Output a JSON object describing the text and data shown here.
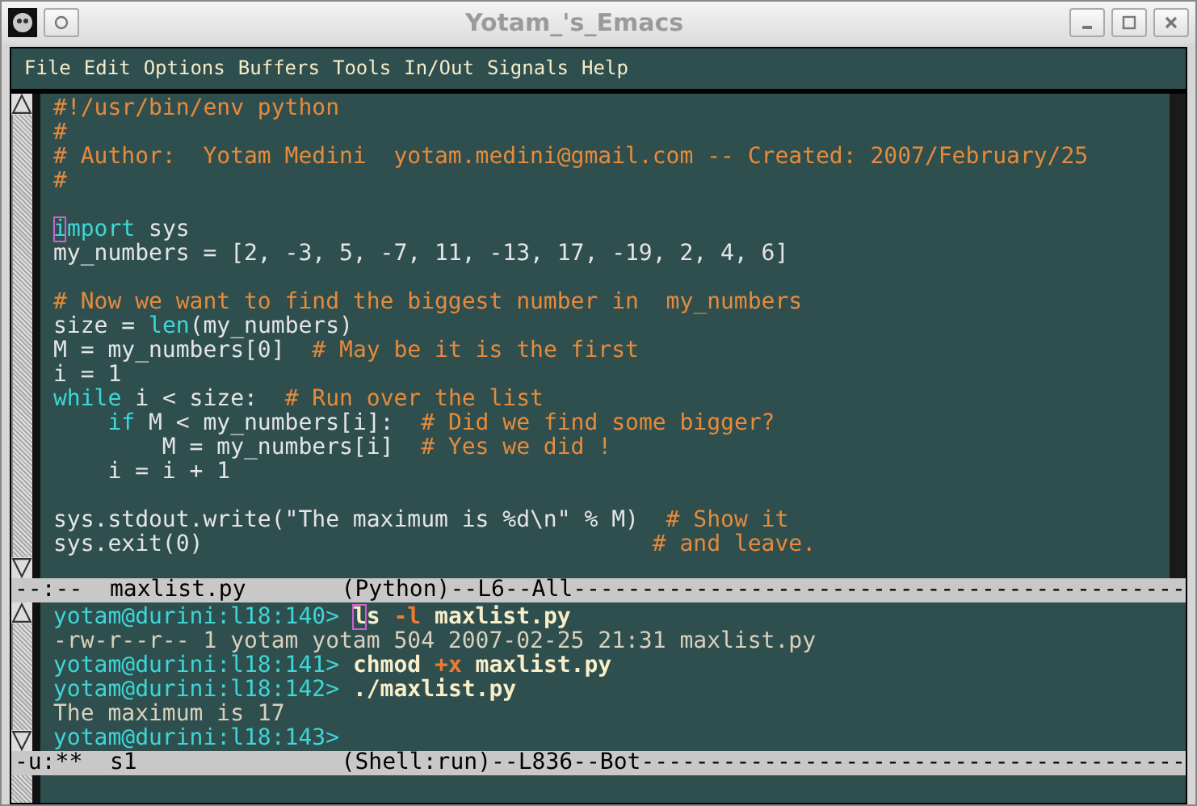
{
  "window": {
    "title": "Yotam_'s_Emacs"
  },
  "menu_bar": [
    "File",
    "Edit",
    "Options",
    "Buffers",
    "Tools",
    "In/Out",
    "Signals",
    "Help"
  ],
  "editor": {
    "blocks": [
      [
        [
          {
            "text": "#!/usr/bin/env python",
            "kind": "comment"
          }
        ],
        [
          {
            "text": "#",
            "kind": "comment"
          }
        ],
        [
          {
            "text": "# Author:  Yotam Medini  yotam.medini@gmail.com -- Created: 2007/February/25",
            "kind": "comment"
          }
        ],
        [
          {
            "text": "#",
            "kind": "comment"
          }
        ]
      ],
      [
        [
          {
            "text": "i",
            "kind": "cursor"
          },
          {
            "text": "mport",
            "kind": "keyword"
          },
          {
            "text": " sys",
            "kind": "plain"
          }
        ],
        [
          {
            "text": "my_numbers = [2, -3, 5, -7, 11, -13, 17, -19, 2, 4, 6]",
            "kind": "plain"
          }
        ]
      ],
      [
        [
          {
            "text": "# Now we want to find the biggest number in  my_numbers",
            "kind": "comment"
          }
        ],
        [
          {
            "text": "size = ",
            "kind": "plain"
          },
          {
            "text": "len",
            "kind": "keyword"
          },
          {
            "text": "(my_numbers)",
            "kind": "plain"
          }
        ],
        [
          {
            "text": "M = my_numbers[0]  ",
            "kind": "plain"
          },
          {
            "text": "# May be it is the first",
            "kind": "comment"
          }
        ],
        [
          {
            "text": "i = 1",
            "kind": "plain"
          }
        ],
        [
          {
            "text": "while",
            "kind": "keyword"
          },
          {
            "text": " i < size:  ",
            "kind": "plain"
          },
          {
            "text": "# Run over the list",
            "kind": "comment"
          }
        ],
        [
          {
            "text": "    if",
            "kind": "keyword"
          },
          {
            "text": " M < my_numbers[i]:  ",
            "kind": "plain"
          },
          {
            "text": "# Did we find some bigger?",
            "kind": "comment"
          }
        ],
        [
          {
            "text": "        M = my_numbers[i]  ",
            "kind": "plain"
          },
          {
            "text": "# Yes we did !",
            "kind": "comment"
          }
        ],
        [
          {
            "text": "    i = i + 1",
            "kind": "plain"
          }
        ]
      ],
      [
        [
          {
            "text": "sys.stdout.write(\"The maximum is %d\\n\" % M)  ",
            "kind": "plain"
          },
          {
            "text": "# Show it",
            "kind": "comment"
          }
        ],
        [
          {
            "text": "sys.exit(0)                                 ",
            "kind": "plain"
          },
          {
            "text": "# and leave.",
            "kind": "comment"
          }
        ]
      ]
    ],
    "mode_line": "--:--  maxlist.py       (Python)--L6--All---------------------------------------------"
  },
  "shell": {
    "blocks": [
      [
        [
          {
            "text": "yotam@durini:l18:140> ",
            "kind": "prompt"
          },
          {
            "text": "l",
            "kind": "cursor"
          },
          {
            "text": "s ",
            "kind": "command"
          },
          {
            "text": "-l",
            "kind": "option"
          },
          {
            "text": " maxlist.py",
            "kind": "command"
          }
        ],
        [
          {
            "text": "-rw-r--r-- 1 yotam yotam 504 2007-02-25 21:31 maxlist.py",
            "kind": "output"
          }
        ],
        [
          {
            "text": "yotam@durini:l18:141> ",
            "kind": "prompt"
          },
          {
            "text": "chmod ",
            "kind": "command"
          },
          {
            "text": "+x",
            "kind": "option"
          },
          {
            "text": " maxlist.py",
            "kind": "command"
          }
        ],
        [
          {
            "text": "yotam@durini:l18:142> ",
            "kind": "prompt"
          },
          {
            "text": "./maxlist.py",
            "kind": "command"
          }
        ],
        [
          {
            "text": "The maximum is 17",
            "kind": "output"
          }
        ],
        [
          {
            "text": "yotam@durini:l18:143>",
            "kind": "prompt"
          }
        ]
      ]
    ],
    "mode_line": "-u:**  s1               (Shell:run)--L836--Bot----------------------------------------"
  }
}
